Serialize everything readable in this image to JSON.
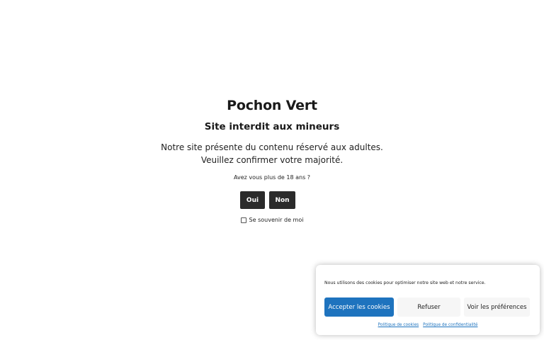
{
  "age_gate": {
    "site_title": "Pochon Vert",
    "heading": "Site interdit aux mineurs",
    "description_line1": "Notre site présente du contenu réservé aux adultes.",
    "description_line2": "Veuillez confirmer votre majorité.",
    "question": "Avez vous plus de 18 ans ?",
    "yes_label": "Oui",
    "no_label": "Non",
    "remember_label": "Se souvenir de moi",
    "remember_checked": false
  },
  "cookie_banner": {
    "message": "Nous utilisons des cookies pour optimiser notre site web et notre service.",
    "accept_label": "Accepter les cookies",
    "refuse_label": "Refuser",
    "preferences_label": "Voir les préférences",
    "cookie_policy_link": "Politique de cookies",
    "privacy_policy_link": "Politique de confidentialité",
    "accent_color": "#1e73be"
  }
}
